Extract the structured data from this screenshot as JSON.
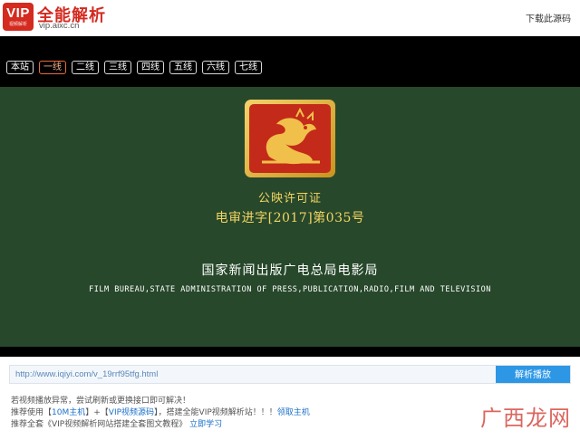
{
  "header": {
    "logo_text": "VIP",
    "logo_subtext": "视频解析",
    "site_name": "全能解析",
    "site_url": "vip.aixc.cn",
    "download_label": "下载此源码"
  },
  "line_tabs": [
    {
      "label": "本站",
      "active": false
    },
    {
      "label": "一线",
      "active": true
    },
    {
      "label": "二线",
      "active": false
    },
    {
      "label": "三线",
      "active": false
    },
    {
      "label": "四线",
      "active": false
    },
    {
      "label": "五线",
      "active": false
    },
    {
      "label": "六线",
      "active": false
    },
    {
      "label": "七线",
      "active": false
    }
  ],
  "video": {
    "license_title": "公映许可证",
    "license_number": "电审进字[2017]第035号",
    "bureau_cn": "国家新闻出版广电总局电影局",
    "bureau_en": "FILM BUREAU,STATE ADMINISTRATION OF PRESS,PUBLICATION,RADIO,FILM AND TELEVISION"
  },
  "url_bar": {
    "value": "http://www.iqiyi.com/v_19rrf95tfg.html",
    "button_label": "解析播放"
  },
  "notices": {
    "line1": "若视频播放异常，尝试刷新或更换接口即可解决！",
    "line2_prefix": "推荐使用【",
    "line2_link1": "10M主机",
    "line2_mid": "】+【",
    "line2_link2": "VIP视频源码",
    "line2_suffix": "】，搭建全能VIP视频解析站！！！",
    "line2_link3": "领取主机",
    "line3_prefix": "推荐全套《VIP视频解析网站搭建全套图文教程》",
    "line3_link": "立即学习"
  },
  "watermark": "广西龙网",
  "colors": {
    "brand_red": "#d42a20",
    "video_green": "#27482b",
    "license_gold": "#f2d562",
    "button_blue": "#2d97e6",
    "link_blue": "#1a6fc9"
  }
}
